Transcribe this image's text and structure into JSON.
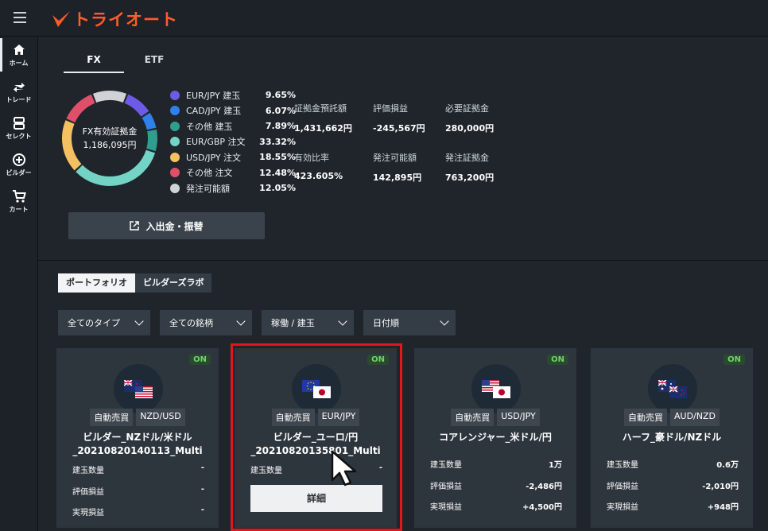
{
  "app": {
    "logo_text": "トライオート",
    "brand_color": "#ff5a2a"
  },
  "sidebar": [
    {
      "icon": "home-icon",
      "label": "ホーム",
      "active": true
    },
    {
      "icon": "trade-icon",
      "label": "トレード",
      "active": false
    },
    {
      "icon": "select-icon",
      "label": "セレクト",
      "active": false
    },
    {
      "icon": "builder-icon",
      "label": "ビルダー",
      "active": false
    },
    {
      "icon": "cart-icon",
      "label": "カート",
      "active": false
    }
  ],
  "tabs": [
    "FX",
    "ETF"
  ],
  "donut": {
    "label_line1": "FX有効証拠金",
    "label_line2": "1,186,095円"
  },
  "legend": [
    {
      "name": "EUR/JPY 建玉",
      "pct": "9.65%",
      "color": "#6d5ae6",
      "value": 9.65
    },
    {
      "name": "CAD/JPY 建玉",
      "pct": "6.07%",
      "color": "#2f80ed",
      "value": 6.07
    },
    {
      "name": "その他 建玉",
      "pct": "7.89%",
      "color": "#2f9e8f",
      "value": 7.89
    },
    {
      "name": "EUR/GBP 注文",
      "pct": "33.32%",
      "color": "#73d3c5",
      "value": 33.32
    },
    {
      "name": "USD/JPY 注文",
      "pct": "18.55%",
      "color": "#f5c060",
      "value": 18.55
    },
    {
      "name": "その他 注文",
      "pct": "12.48%",
      "color": "#e04f6a",
      "value": 12.48
    },
    {
      "name": "発注可能額",
      "pct": "12.05%",
      "color": "#cfd3d6",
      "value": 12.05
    }
  ],
  "stats": [
    {
      "label": "証拠金預託額",
      "value": "1,431,662円"
    },
    {
      "label": "評価損益",
      "value": "-245,567円"
    },
    {
      "label": "必要証拠金",
      "value": "280,000円"
    },
    {
      "label": "有効比率",
      "value": "423.605%"
    },
    {
      "label": "発注可能額",
      "value": "142,895円"
    },
    {
      "label": "発注証拠金",
      "value": "763,200円"
    }
  ],
  "deposit_button": "入出金・振替",
  "subtabs": [
    "ポートフォリオ",
    "ビルダーズラボ"
  ],
  "filters": [
    "全てのタイプ",
    "全ての銘柄",
    "稼働 / 建玉",
    "日付順"
  ],
  "cards": [
    {
      "status": "ON",
      "tag1": "自動売買",
      "tag2": "NZD/USD",
      "title1": "ビルダー_NZドル/米ドル",
      "title2": "_20210820140113_Multi",
      "flags": [
        "nz",
        "us"
      ],
      "metrics": [
        {
          "k": "建玉数量",
          "v": "-"
        },
        {
          "k": "評価損益",
          "v": "-"
        },
        {
          "k": "実現損益",
          "v": "-"
        }
      ]
    },
    {
      "status": "ON",
      "tag1": "自動売買",
      "tag2": "EUR/JPY",
      "title1": "ビルダー_ユーロ/円",
      "title2": "_20210820135801_Multi",
      "flags": [
        "eu",
        "jp"
      ],
      "metrics": [
        {
          "k": "建玉数量",
          "v": "-"
        }
      ],
      "detail_button": "詳細"
    },
    {
      "status": "ON",
      "tag1": "自動売買",
      "tag2": "USD/JPY",
      "title1": "コアレンジャー_米ドル/円",
      "title2": "",
      "flags": [
        "us",
        "jp"
      ],
      "metrics": [
        {
          "k": "建玉数量",
          "v": "1万"
        },
        {
          "k": "評価損益",
          "v": "-2,486円"
        },
        {
          "k": "実現損益",
          "v": "+4,500円"
        }
      ]
    },
    {
      "status": "ON",
      "tag1": "自動売買",
      "tag2": "AUD/NZD",
      "title1": "ハーフ_豪ドル/NZドル",
      "title2": "",
      "flags": [
        "au",
        "nz"
      ],
      "metrics": [
        {
          "k": "建玉数量",
          "v": "0.6万"
        },
        {
          "k": "評価損益",
          "v": "-2,010円"
        },
        {
          "k": "実現損益",
          "v": "+948円"
        }
      ]
    }
  ]
}
